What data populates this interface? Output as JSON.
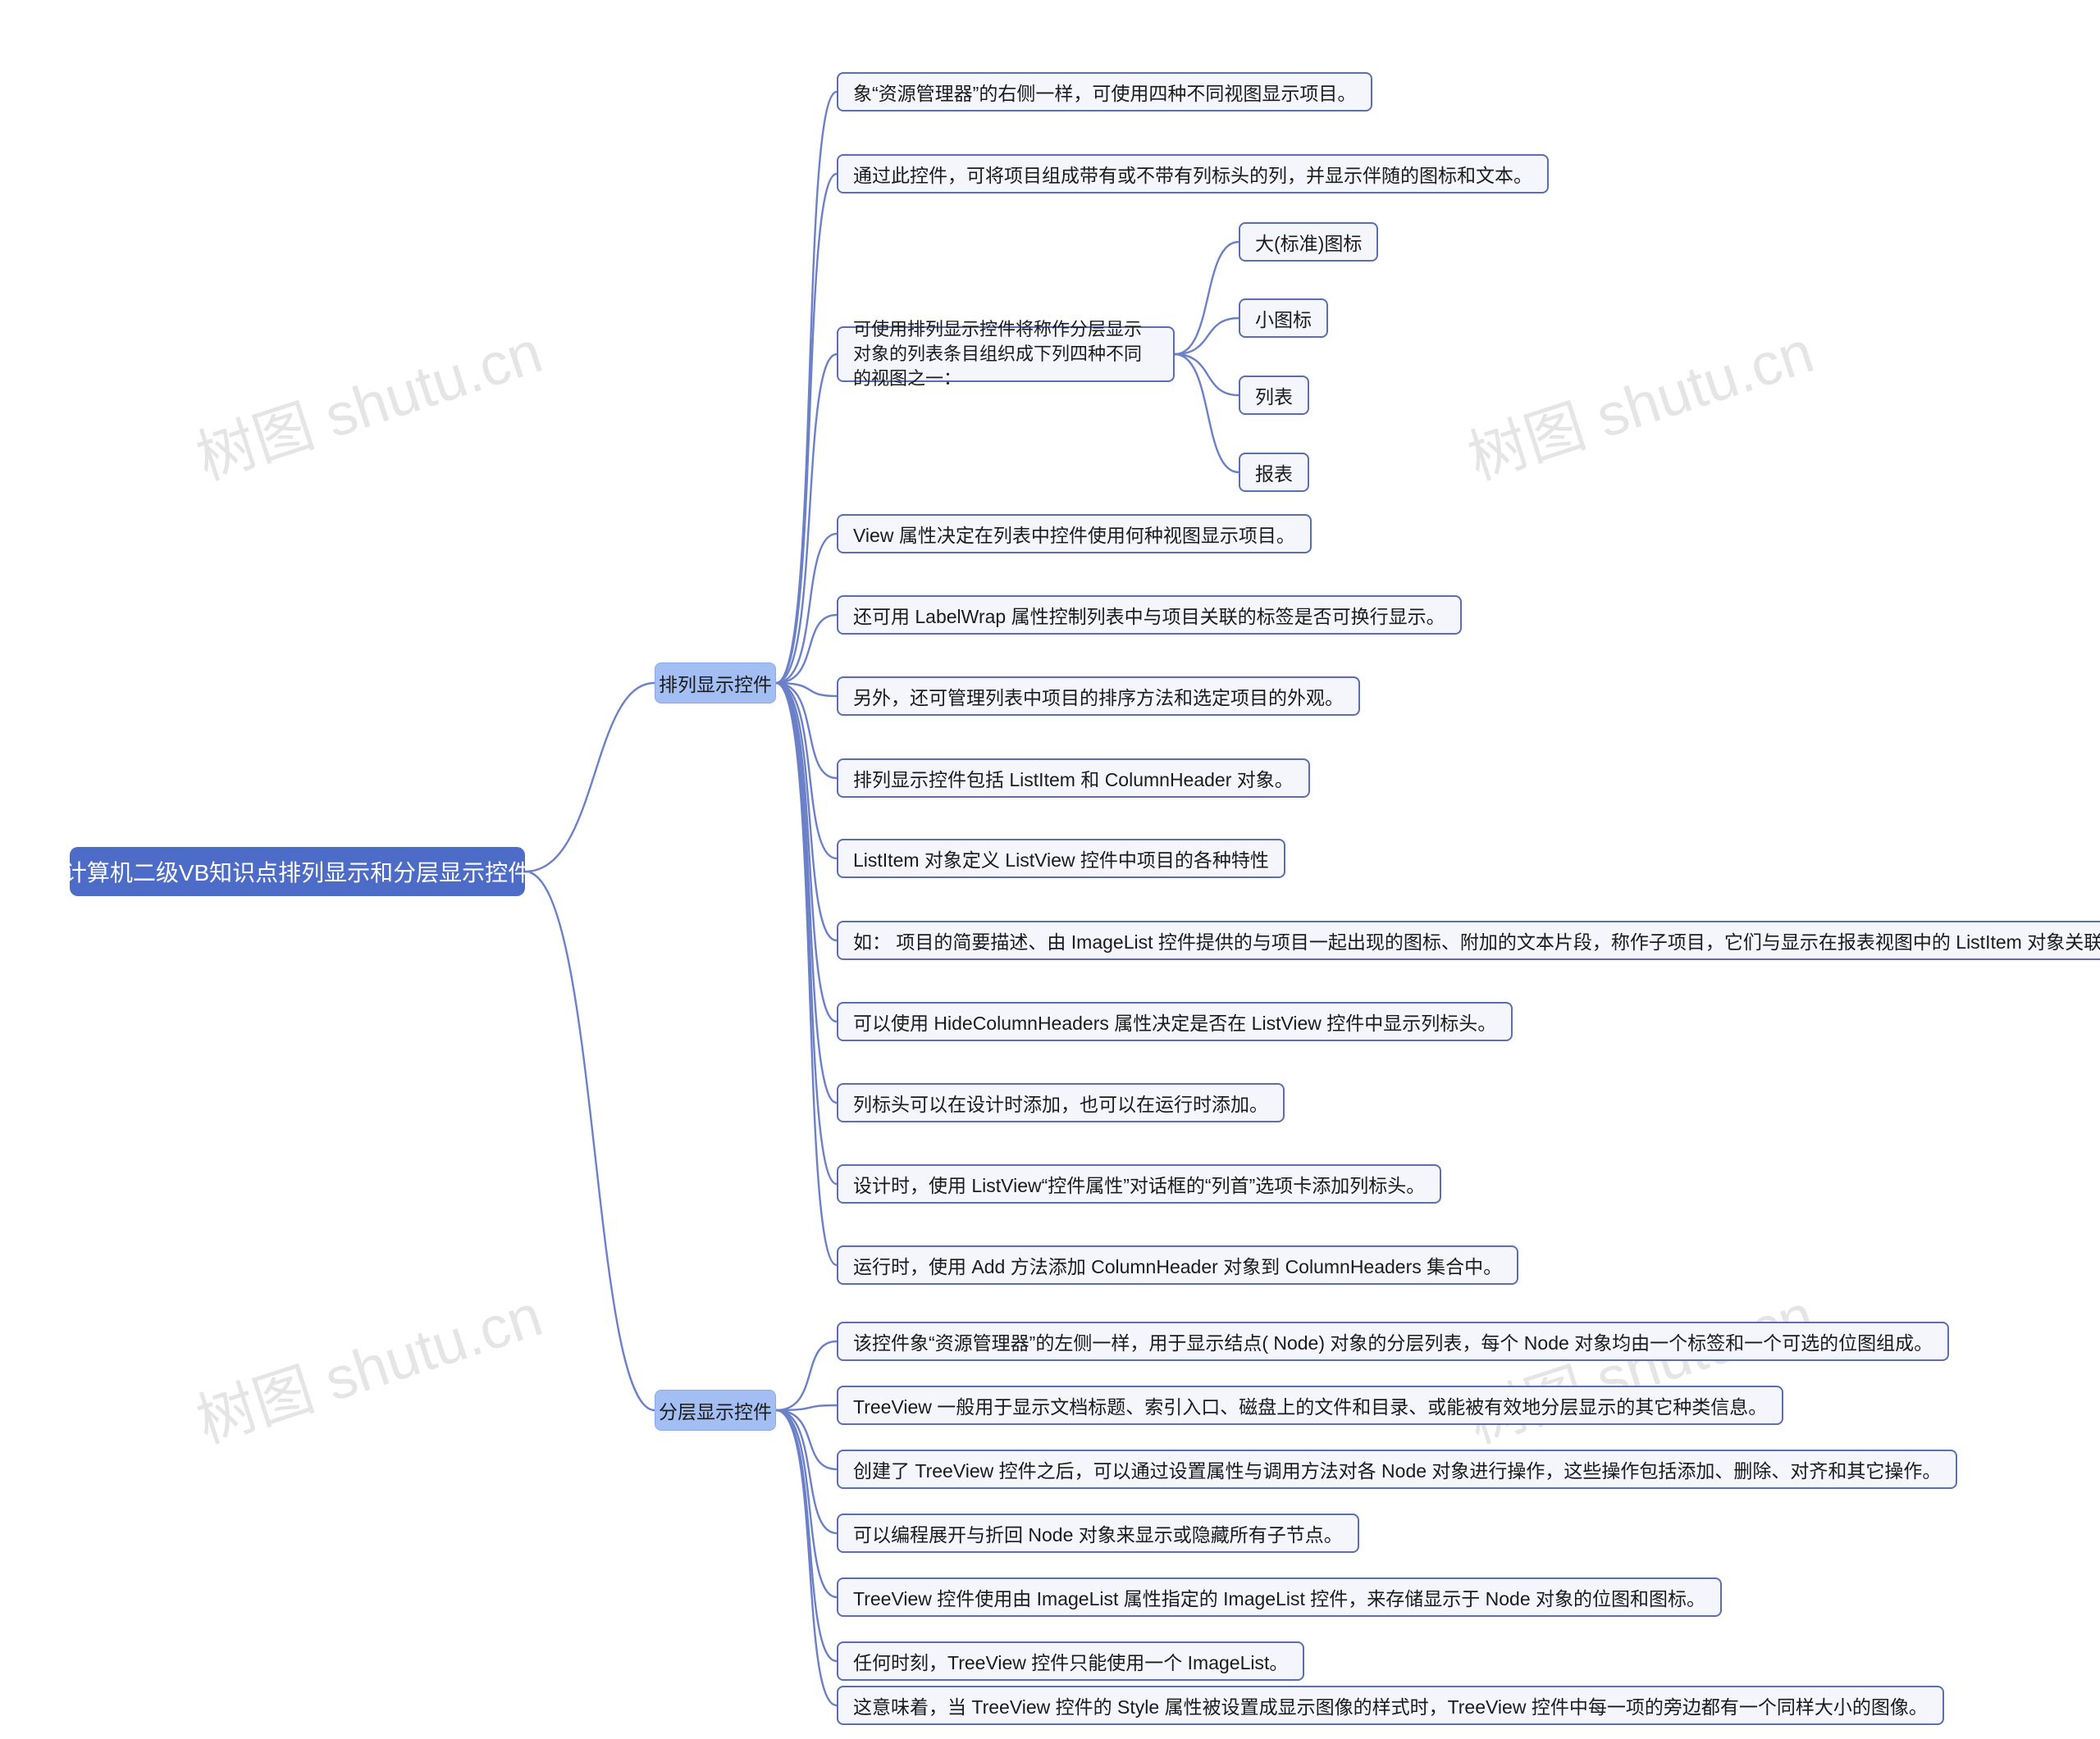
{
  "root": {
    "title": "计算机二级VB知识点排列显示和分层显示控件"
  },
  "branch1": {
    "title": "排列显示控件",
    "items": [
      "象“资源管理器”的右侧一样，可使用四种不同视图显示项目。",
      "通过此控件，可将项目组成带有或不带有列标头的列，并显示伴随的图标和文本。",
      "可使用排列显示控件将称作分层显示对象的列表条目组织成下列四种不同的视图之一：",
      "View 属性决定在列表中控件使用何种视图显示项目。",
      "还可用 LabelWrap 属性控制列表中与项目关联的标签是否可换行显示。",
      "另外，还可管理列表中项目的排序方法和选定项目的外观。",
      "排列显示控件包括 ListItem 和 ColumnHeader 对象。",
      "ListItem 对象定义 ListView 控件中项目的各种特性",
      "如： 项目的简要描述、由 ImageList 控件提供的与项目一起出现的图标、附加的文本片段，称作子项目，它们与显示在报表视图中的 ListItem 对象关联。",
      "可以使用 HideColumnHeaders 属性决定是否在 ListView 控件中显示列标头。",
      "列标头可以在设计时添加，也可以在运行时添加。",
      "设计时，使用 ListView“控件属性”对话框的“列首”选项卡添加列标头。",
      "运行时，使用 Add 方法添加 ColumnHeader 对象到 ColumnHeaders 集合中。"
    ],
    "views": [
      "大(标准)图标",
      "小图标",
      "列表",
      "报表"
    ]
  },
  "branch2": {
    "title": "分层显示控件",
    "items": [
      "该控件象“资源管理器”的左侧一样，用于显示结点( Node) 对象的分层列表，每个 Node 对象均由一个标签和一个可选的位图组成。",
      "TreeView 一般用于显示文档标题、索引入口、磁盘上的文件和目录、或能被有效地分层显示的其它种类信息。",
      "创建了 TreeView 控件之后，可以通过设置属性与调用方法对各 Node 对象进行操作，这些操作包括添加、删除、对齐和其它操作。",
      "可以编程展开与折回 Node 对象来显示或隐藏所有子节点。",
      "TreeView 控件使用由 ImageList 属性指定的 ImageList 控件，来存储显示于 Node 对象的位图和图标。",
      "任何时刻，TreeView 控件只能使用一个 ImageList。",
      "这意味着，当 TreeView 控件的 Style 属性被设置成显示图像的样式时，TreeView 控件中每一项的旁边都有一个同样大小的图像。"
    ]
  },
  "watermarks": [
    "树图 shutu.cn",
    "树图 shutu.cn",
    "树图 shutu.cn",
    "树图 shutu.cn"
  ]
}
